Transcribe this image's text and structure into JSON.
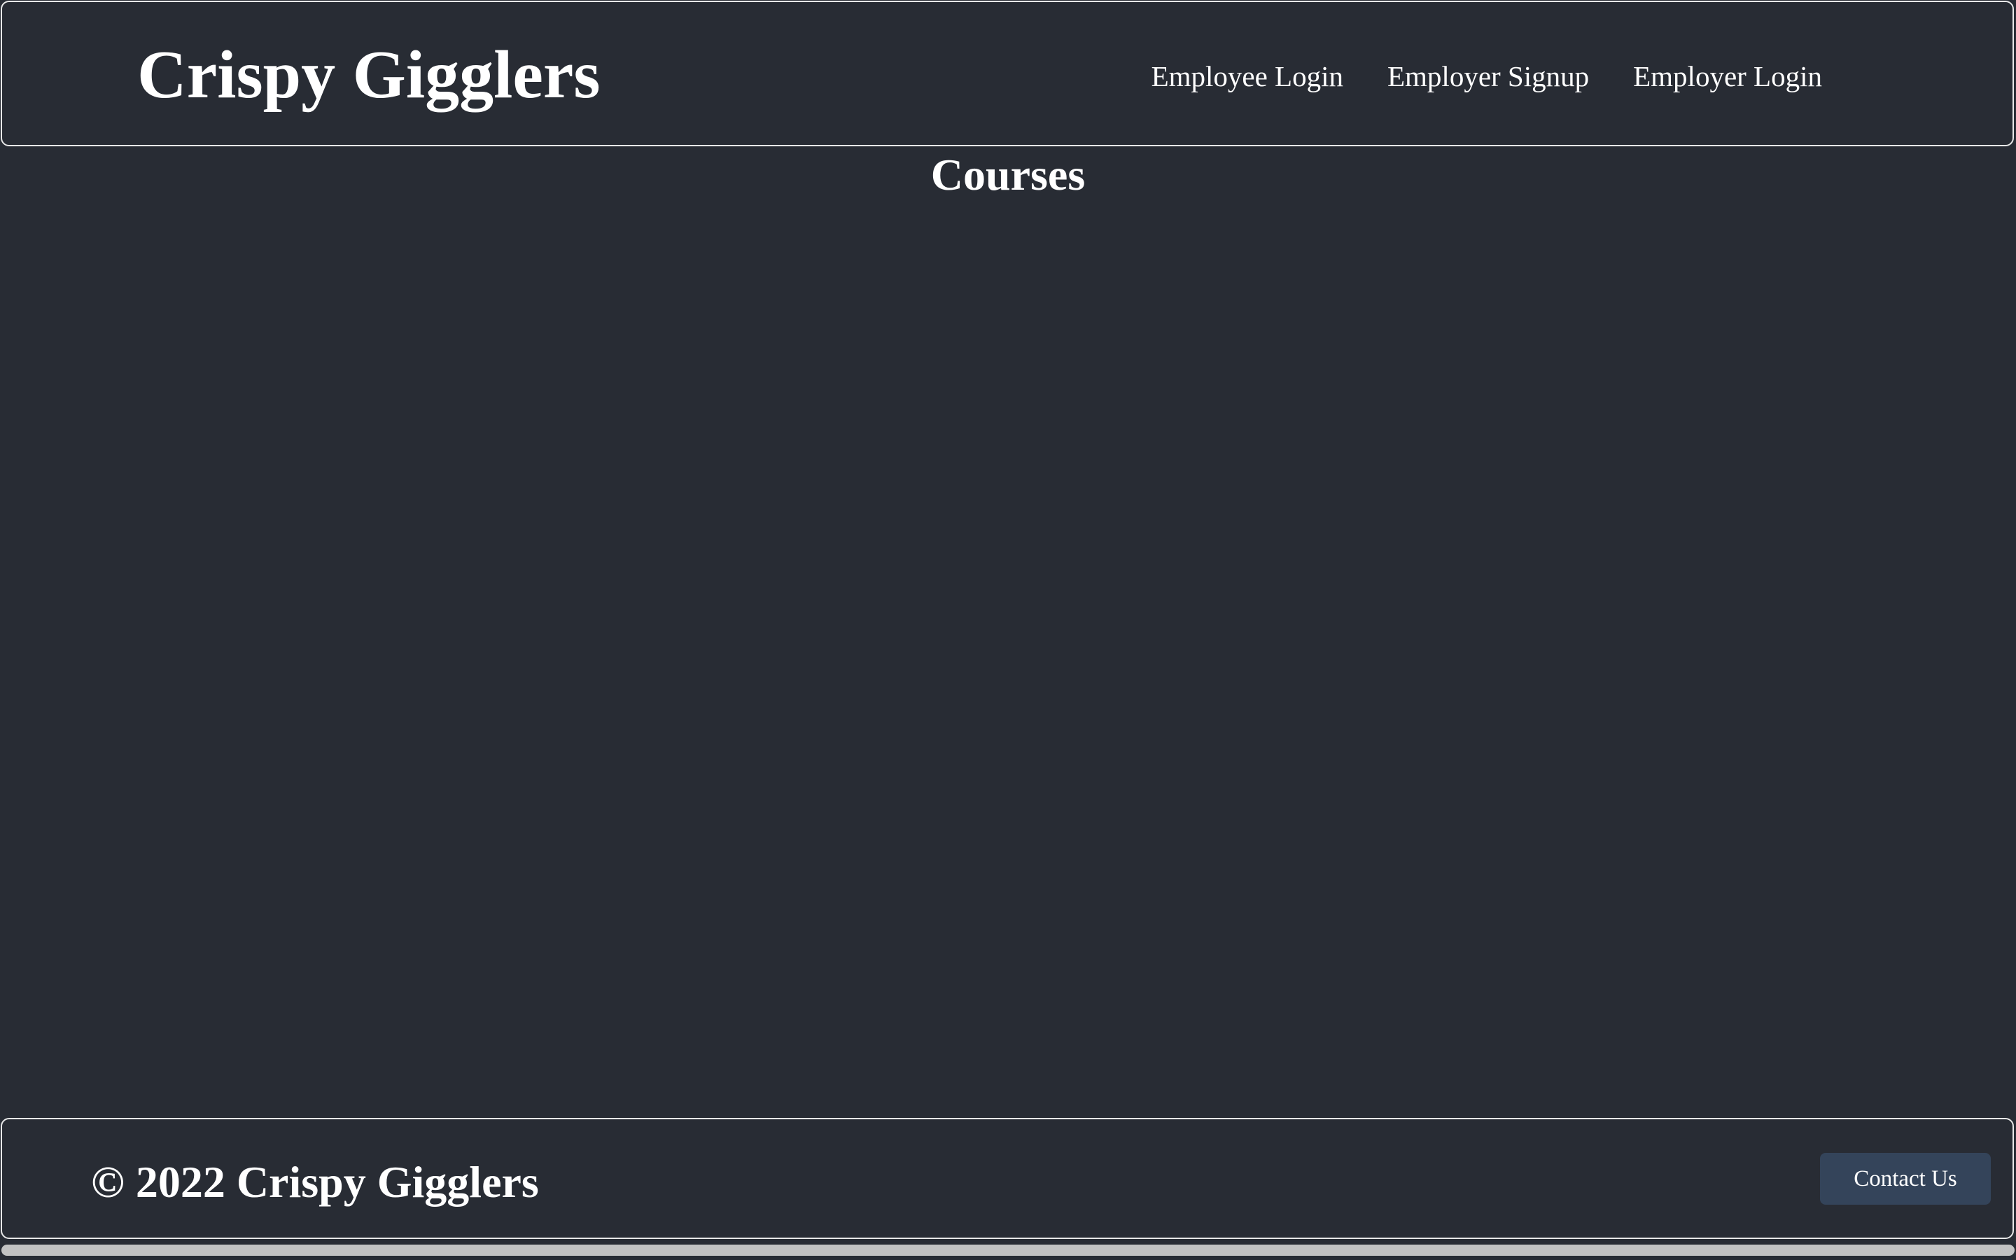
{
  "header": {
    "brand": "Crispy Gigglers",
    "nav": [
      {
        "label": "Employee Login"
      },
      {
        "label": "Employer Signup"
      },
      {
        "label": "Employer Login"
      }
    ]
  },
  "main": {
    "title": "Courses"
  },
  "footer": {
    "copyright": "© 2022 Crispy Gigglers",
    "contact_label": "Contact Us"
  },
  "colors": {
    "background": "#282c34",
    "border": "#e8e8e8",
    "button": "#34445a",
    "text": "#ffffff"
  }
}
